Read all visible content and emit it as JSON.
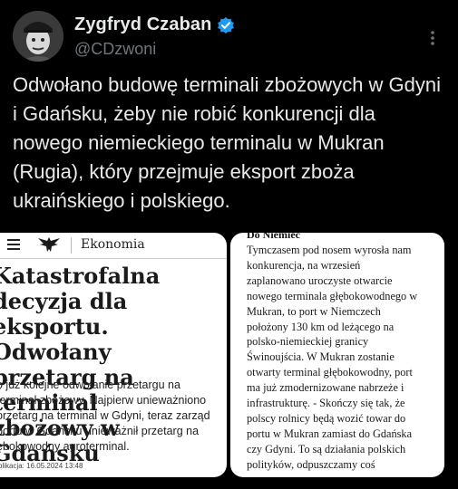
{
  "author": {
    "display_name": "Zygfryd Czaban",
    "handle": "@CDzwoni"
  },
  "icons": {
    "verified": "verified-badge-icon",
    "more": "more-options-icon",
    "menu": "hamburger-menu-icon",
    "logo": "eagle-logo-icon"
  },
  "colors": {
    "background": "#000000",
    "text": "#e7e9ea",
    "secondary": "#71767b",
    "verified": "#1d9bf0"
  },
  "tweet": {
    "text": "Odwołano budowę terminali zbożowych w Gdyni i Gdańsku, żeby nie robić konkurencji dla nowego niemieckiego terminalu w Mukran (Rugia), który przejmuje eksport zboża ukraińskiego i polskiego."
  },
  "media_left": {
    "section": "Ekonomia",
    "headline": "Katastrofalna decyzja dla\neksportu. Odwołany\nprzetarg na terminal\nzbożowy w Gdańsku",
    "lead": "o już kolejne odwołanie przetargu na\nterminal zbożowy. Najpierw unieważniono\nprzetarg na terminal w Gdyni, teraz zarząd\nportu w Gdańsku unieważnił przetarg na\nębokowodny agroterminal.",
    "published": "blikacja: 16.05.2024 13:48"
  },
  "media_right": {
    "heading": "Do Niemiec",
    "body": "Tymczasem pod nosem wyrosła nam\nkonkurencja, na wrzesień\nzaplanowano uroczyste otwarcie\nnowego terminala głębokowodnego w\nMukran, to port w Niemczech\npołożony 130 km od leżącego na\npolsko-niemieckiej granicy\nŚwinoujścia. W Mukran zostanie\notwarty terminal głębokowodny, port\nma już zmodernizowane nabrzeże i\ninfrastrukturę. - Skończy się tak, że\npolscy rolnicy będą wozić towar do\nportu w Mukran zamiast do Gdańska\nczy Gdyni. To są  działania polskich\npolityków, odpuszczamy coś"
  }
}
